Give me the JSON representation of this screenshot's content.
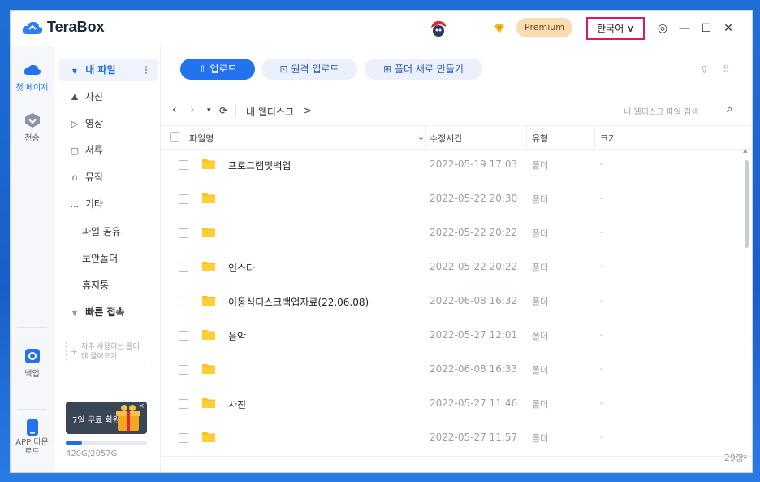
{
  "app": {
    "name": "TeraBox"
  },
  "titlebar": {
    "premium_label": "Premium",
    "language_label": "한국어 ∨",
    "settings_glyph": "◎",
    "minimize_glyph": "—",
    "maximize_glyph": "☐",
    "close_glyph": "✕"
  },
  "rail": {
    "items": [
      {
        "label": "첫 페이지",
        "icon": "cloud-icon"
      },
      {
        "label": "전송",
        "icon": "transfer-icon"
      },
      {
        "label": "백업",
        "icon": "backup-icon"
      },
      {
        "label": "APP 다운로드",
        "icon": "phone-icon"
      }
    ]
  },
  "sidebar": {
    "my_files": "내 파일",
    "more_glyph": "⋮",
    "categories": [
      {
        "label": "사진",
        "glyph": "⛰"
      },
      {
        "label": "영상",
        "glyph": "▷"
      },
      {
        "label": "서류",
        "glyph": "▢"
      },
      {
        "label": "뮤직",
        "glyph": "∩"
      },
      {
        "label": "기타",
        "glyph": "…"
      }
    ],
    "links": [
      "파일 공유",
      "보안폴더",
      "휴지통"
    ],
    "quick_access": "빠른 접속",
    "quick_placeholder": "자주 사용하는 폴더에 끌어오기",
    "promo_text": "7일 무료 회원",
    "promo_close": "×",
    "storage_text": "420G/2057G",
    "storage_used_fraction": 0.2
  },
  "toolbar": {
    "upload": "업로드",
    "remote_upload": "원격 업로드",
    "new_folder": "폴더 새로 만들기"
  },
  "nav": {
    "back": "‹",
    "forward": "›",
    "dropdown": "▾",
    "refresh": "⟳",
    "path": "내 웹디스크",
    "path_sep": ">",
    "search_placeholder": "내 웹디스크 파일 검색",
    "search_glyph": "⌕"
  },
  "table": {
    "headers": {
      "name": "파일명",
      "modified": "수정시간",
      "type": "유형",
      "size": "크기"
    },
    "sort_glyph": "↓",
    "rows": [
      {
        "name": "프로그램및백업",
        "modified": "2022-05-19 17:03",
        "type": "폴더",
        "size": "-"
      },
      {
        "name": "",
        "modified": "2022-05-22 20:30",
        "type": "폴더",
        "size": "-"
      },
      {
        "name": "",
        "modified": "2022-05-22 20:22",
        "type": "폴더",
        "size": "-"
      },
      {
        "name": "인스타",
        "modified": "2022-05-22 20:22",
        "type": "폴더",
        "size": "-"
      },
      {
        "name": "이동식디스크백업자료(22.06.08)",
        "modified": "2022-06-08 16:32",
        "type": "폴더",
        "size": "-"
      },
      {
        "name": "음악",
        "modified": "2022-05-27 12:01",
        "type": "폴더",
        "size": "-"
      },
      {
        "name": "",
        "modified": "2022-06-08 16:33",
        "type": "폴더",
        "size": "-"
      },
      {
        "name": "사진",
        "modified": "2022-05-27 11:46",
        "type": "폴더",
        "size": "-"
      },
      {
        "name": "",
        "modified": "2022-05-27 11:57",
        "type": "폴더",
        "size": "-"
      }
    ],
    "count": "29항"
  },
  "colors": {
    "accent": "#2372EE",
    "highlight": "#E0185C",
    "folder": "#FFC21A",
    "premium_bg": "#F7DDB0"
  }
}
